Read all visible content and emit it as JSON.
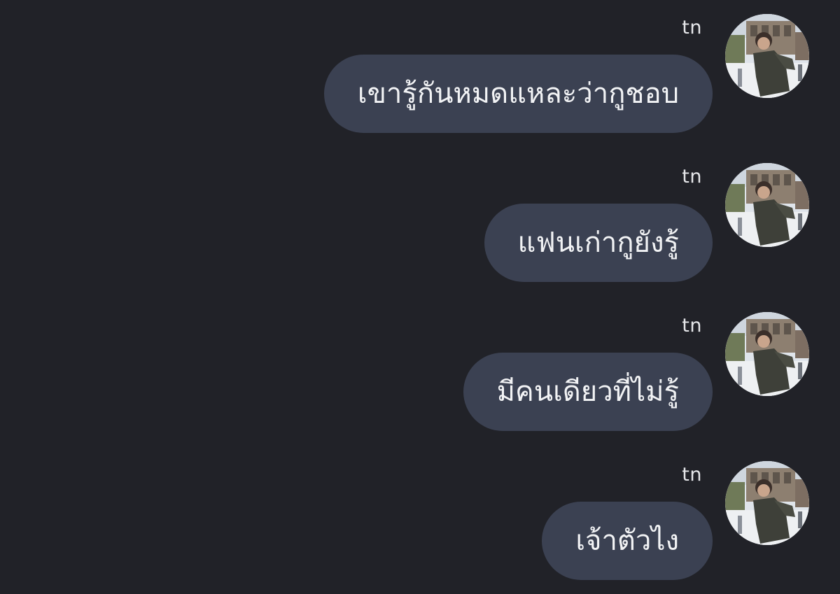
{
  "conversation": {
    "messages": [
      {
        "sender": "tn",
        "text": "เขารู้กันหมดแหละว่ากูชอบ"
      },
      {
        "sender": "tn",
        "text": "แฟนเก่ากูยังรู้"
      },
      {
        "sender": "tn",
        "text": "มีคนเดียวที่ไม่รู้"
      },
      {
        "sender": "tn",
        "text": "เจ้าตัวไง"
      }
    ]
  },
  "colors": {
    "background": "#212228",
    "bubble": "#3b4152",
    "text": "#f2f3f5"
  },
  "icons": {
    "avatar": "profile-photo"
  }
}
